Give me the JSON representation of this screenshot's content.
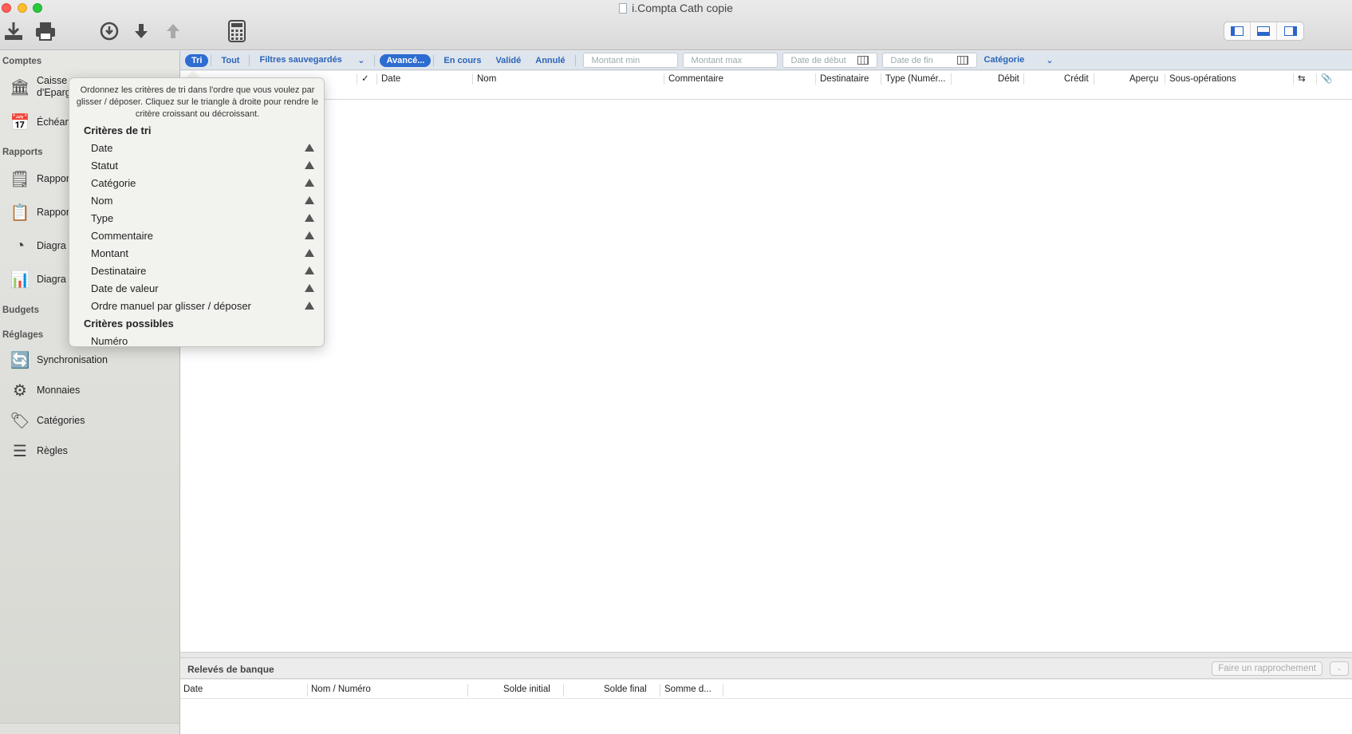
{
  "window": {
    "title": "i.Compta Cath copie"
  },
  "toolbar": {
    "icons": [
      "download-icon",
      "print-icon",
      "circle-down-icon",
      "arrow-down-icon",
      "arrow-up-icon",
      "calculator-icon"
    ]
  },
  "sidebar": {
    "sections": {
      "comptes": "Comptes",
      "rapports": "Rapports",
      "budgets": "Budgets",
      "reglages": "Réglages"
    },
    "items": {
      "caisse_line1": "Caisse",
      "caisse_line2": "d'Eparg",
      "echeances": "Échéan",
      "rapport1": "Rappor",
      "rapport2": "Rappor",
      "diagramme1": "Diagra",
      "diagramme2": "Diagra",
      "synchronisation": "Synchronisation",
      "monnaies": "Monnaies",
      "categories": "Catégories",
      "regles": "Règles"
    }
  },
  "filterbar": {
    "tri": "Tri",
    "tout": "Tout",
    "filtres": "Filtres sauvegardés",
    "avance": "Avancé...",
    "en_cours": "En cours",
    "valide": "Validé",
    "annule": "Annulé",
    "montant_min": "Montant min",
    "montant_max": "Montant max",
    "date_debut": "Date de début",
    "date_fin": "Date de fin",
    "categorie": "Catégorie"
  },
  "columns": {
    "check": "✓",
    "date": "Date",
    "nom": "Nom",
    "commentaire": "Commentaire",
    "destinataire": "Destinataire",
    "type": "Type (Numér...",
    "debit": "Débit",
    "credit": "Crédit",
    "apercu": "Aperçu",
    "sous_operations": "Sous-opérations"
  },
  "popover": {
    "help": "Ordonnez les critères de tri dans l'ordre que vous voulez par glisser / déposer. Cliquez sur le triangle à droite pour rendre le critère croissant ou décroissant.",
    "criteres_tri": "Critères de tri",
    "sort_items": [
      "Date",
      "Statut",
      "Catégorie",
      "Nom",
      "Type",
      "Commentaire",
      "Montant",
      "Destinataire",
      "Date de valeur",
      "Ordre manuel par glisser / déposer"
    ],
    "criteres_possibles": "Critères possibles",
    "possible_items": [
      "Numéro"
    ]
  },
  "statements": {
    "title": "Relevés de banque",
    "button": "Faire un rapprochement",
    "minus": "-",
    "columns": {
      "date": "Date",
      "nom_numero": "Nom / Numéro",
      "solde_initial": "Solde initial",
      "solde_final": "Solde final",
      "somme": "Somme d..."
    }
  },
  "colors": {
    "accent": "#2d6cd1",
    "link": "#2a64b8"
  }
}
